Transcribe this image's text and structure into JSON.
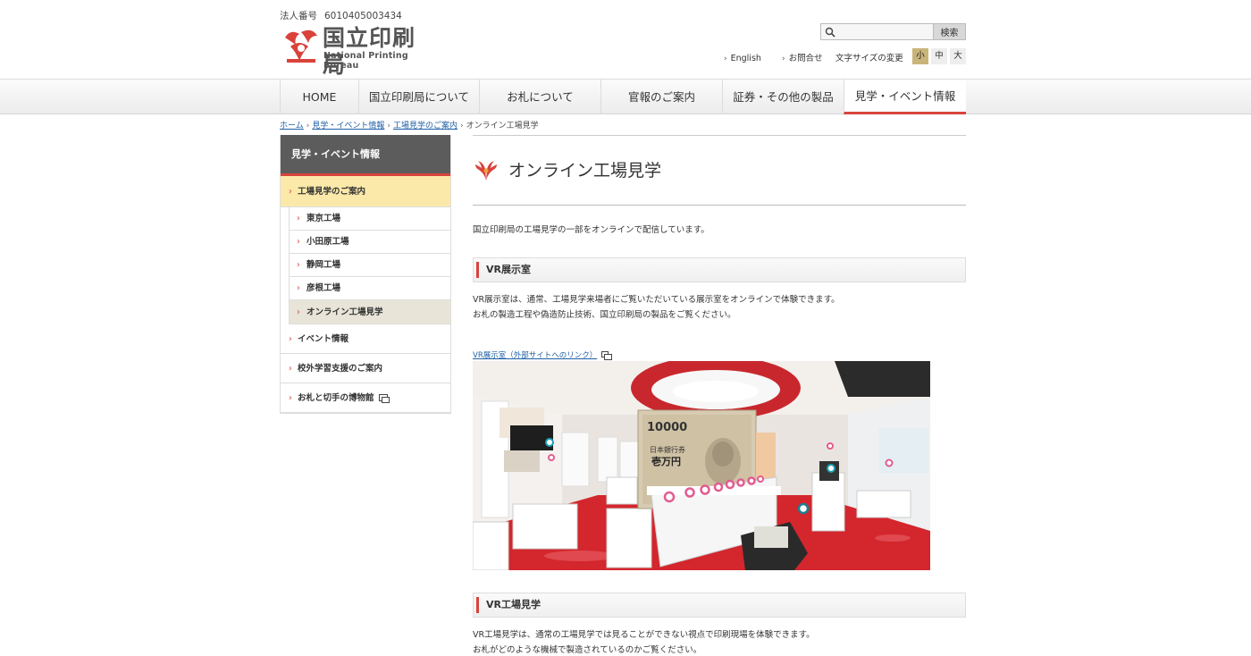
{
  "header": {
    "corp_no_label": "法人番号",
    "corp_no": "6010405003434",
    "logo_jp": "国立印刷局",
    "logo_en": "National Printing Bureau",
    "search_placeholder": "",
    "search_button": "検索",
    "util_links": [
      "English",
      "お問合せ"
    ],
    "fontsize_label": "文字サイズの変更",
    "fontsize_options": [
      "小",
      "中",
      "大"
    ],
    "fontsize_selected": "小"
  },
  "gnav": {
    "items": [
      "HOME",
      "国立印刷局について",
      "お札について",
      "官報のご案内",
      "証券・その他の製品",
      "見学・イベント情報"
    ],
    "active": "見学・イベント情報"
  },
  "breadcrumb": {
    "items": [
      "ホーム",
      "見学・イベント情報",
      "工場見学のご案内"
    ],
    "current": "オンライン工場見学"
  },
  "sidebar": {
    "heading": "見学・イベント情報",
    "current_section": "工場見学のご案内",
    "sub_items": [
      "東京工場",
      "小田原工場",
      "静岡工場",
      "彦根工場",
      "オンライン工場見学"
    ],
    "current_sub": "オンライン工場見学",
    "other_items": [
      "イベント情報",
      "校外学習支援のご案内",
      "お札と切手の博物館"
    ]
  },
  "main": {
    "title": "オンライン工場見学",
    "intro": "国立印刷局の工場見学の一部をオンラインで配信しています。",
    "sections": [
      {
        "heading": "VR展示室",
        "lines": [
          "VR展示室は、通常、工場見学来場者にご覧いただいている展示室をオンラインで体験できます。",
          "お札の製造工程や偽造防止技術、国立印刷局の製品をご覧ください。"
        ],
        "link": "VR展示室（外部サイトへのリンク）",
        "banknote_text": [
          "10000",
          "日本銀行券",
          "壱万円"
        ]
      },
      {
        "heading": "VR工場見学",
        "lines": [
          "VR工場見学は、通常の工場見学では見ることができない視点で印刷現場を体験できます。",
          "お札がどのような機械で製造されているのかご覧ください。"
        ]
      }
    ]
  },
  "colors": {
    "accent_red": "#d9433b",
    "sidebar_head": "#5c5c5c",
    "current_yellow": "#fbe9a9",
    "link_blue": "#1f5fa6"
  }
}
